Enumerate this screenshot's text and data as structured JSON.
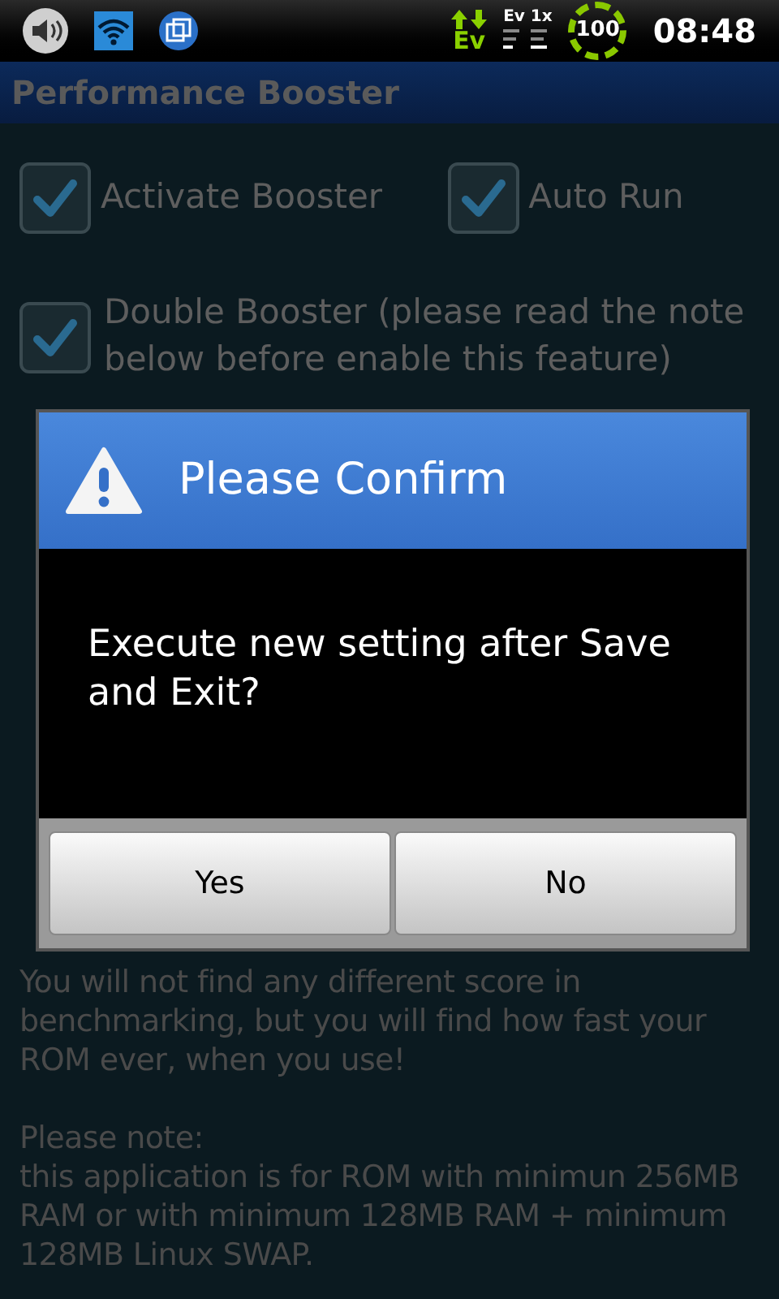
{
  "status_bar": {
    "data_icon_label": "Ev",
    "signal_label": "Ev 1x",
    "battery": "100",
    "time": "08:48"
  },
  "window": {
    "title": "Performance Booster"
  },
  "options": [
    {
      "label": "Activate Booster",
      "checked": true
    },
    {
      "label": "Auto Run",
      "checked": true
    },
    {
      "label": "Double Booster (please read the note below before enable this feature)",
      "checked": true
    }
  ],
  "notes": [
    "You will not find any different score in benchmarking, but you will find how fast your ROM ever, when you use!",
    "Please note:\nthis application is for ROM with minimun 256MB RAM or with minimum 128MB RAM + minimum 128MB Linux SWAP."
  ],
  "dialog": {
    "title": "Please Confirm",
    "message": "Execute new setting after Save and Exit?",
    "buttons": [
      "Yes",
      "No"
    ]
  }
}
